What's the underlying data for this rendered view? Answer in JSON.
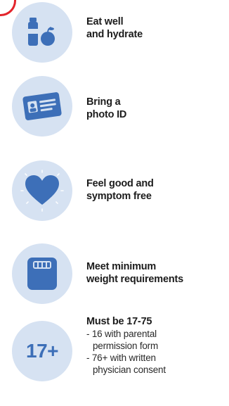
{
  "colors": {
    "circle_bg": "#d6e2f2",
    "icon_blue": "#3d6fb8",
    "accent_red": "#e3242b",
    "text": "#1c1c1c"
  },
  "items": [
    {
      "icon": "bottle-apple-icon",
      "title_lines": [
        "Eat well",
        "and hydrate"
      ]
    },
    {
      "icon": "photo-id-card-icon",
      "title_lines": [
        "Bring a",
        "photo ID"
      ]
    },
    {
      "icon": "heart-icon",
      "title_lines": [
        "Feel good and",
        "symptom free"
      ]
    },
    {
      "icon": "scale-icon",
      "title_lines": [
        "Meet minimum",
        "weight requirements"
      ]
    },
    {
      "icon": "age-badge",
      "badge_text": "17+",
      "title_lines": [
        "Must be 17-75"
      ],
      "details": [
        [
          "- 16 with parental",
          "permission form"
        ],
        [
          "- 76+ with written",
          "physician consent"
        ]
      ]
    }
  ]
}
